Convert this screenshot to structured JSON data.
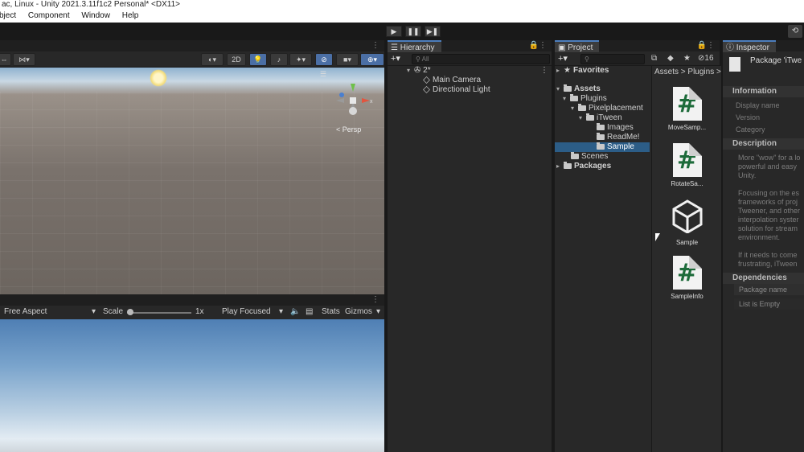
{
  "window": {
    "title": "ac, Linux - Unity 2021.3.11f1c2 Personal* <DX11>"
  },
  "menubar": {
    "items": [
      "bject",
      "Component",
      "Window",
      "Help"
    ]
  },
  "toolbar": {
    "play": "▶",
    "pause": "❚❚",
    "step": "▶❚",
    "right_icon": "⟲"
  },
  "scene": {
    "toolbar": {
      "twod": "2D"
    },
    "gizmo": {
      "persp": "< Persp"
    }
  },
  "game": {
    "aspect": "Free Aspect",
    "scale_label": "Scale",
    "scale_value": "1x",
    "play_mode": "Play Focused",
    "stats": "Stats",
    "gizmos": "Gizmos"
  },
  "hierarchy": {
    "tab": "Hierarchy",
    "search_placeholder": "All",
    "scene_name": "2*",
    "items": [
      "Main Camera",
      "Directional Light"
    ]
  },
  "project": {
    "tab": "Project",
    "count": "16",
    "favorites": "Favorites",
    "tree": {
      "assets": "Assets",
      "plugins": "Plugins",
      "pixelplacement": "Pixelplacement",
      "itween": "iTween",
      "images": "Images",
      "readme": "ReadMe!",
      "sample": "Sample",
      "scenes": "Scenes",
      "packages": "Packages"
    },
    "breadcrumb": "Assets > Plugins >",
    "assets": [
      {
        "label": "MoveSamp...",
        "kind": "script"
      },
      {
        "label": "RotateSa...",
        "kind": "script"
      },
      {
        "label": "Sample",
        "kind": "unity-scene"
      },
      {
        "label": "SampleInfo",
        "kind": "script"
      }
    ]
  },
  "inspector": {
    "tab": "Inspector",
    "title": "Package 'iTwe",
    "information": "Information",
    "fields": [
      "Display name",
      "Version",
      "Category"
    ],
    "description": "Description",
    "desc_lines": [
      "More \"wow\" for a lo",
      "powerful and easy",
      "Unity.",
      "",
      "Focusing on the es",
      "frameworks of proj",
      "Tweener, and other",
      "interpolation syster",
      "solution for stream",
      "environment.",
      "",
      "If it needs to come",
      "frustrating, iTween"
    ],
    "dependencies": "Dependencies",
    "dep_rows": [
      "Package name",
      "List is Empty"
    ]
  },
  "colors": {
    "selection": "#2c5d87",
    "tab_accent": "#4c7ebd",
    "toggle_active": "#4b6fa5"
  }
}
